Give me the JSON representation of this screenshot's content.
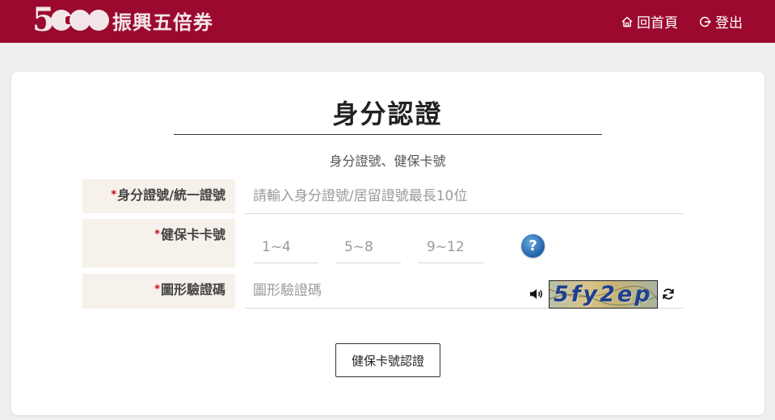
{
  "header": {
    "logo_number": "5000",
    "logo_text": "振興五倍券",
    "nav": {
      "home_label": "回首頁",
      "logout_label": "登出"
    }
  },
  "page": {
    "title": "身分認證",
    "subtitle": "身分證號、健保卡號"
  },
  "form": {
    "id": {
      "label": "身分證號/統一證號",
      "placeholder": "請輸入身分證號/居留證號最長10位",
      "value": ""
    },
    "nhi_card": {
      "label": "健保卡卡號",
      "segments": [
        {
          "placeholder": "1~4",
          "value": ""
        },
        {
          "placeholder": "5~8",
          "value": ""
        },
        {
          "placeholder": "9~12",
          "value": ""
        }
      ],
      "help_symbol": "?"
    },
    "captcha": {
      "label": "圖形驗證碼",
      "placeholder": "圖形驗證碼",
      "value": "",
      "image_text": "5fy2ep"
    },
    "required_mark": "*",
    "submit_label": "健保卡號認證"
  },
  "colors": {
    "brand": "#9b0a2e",
    "label_bg": "#f6f1ea",
    "required": "#d0021b"
  },
  "icons": {
    "home": "home-icon",
    "logout": "logout-icon",
    "help": "help-icon",
    "audio": "speaker-icon",
    "refresh": "refresh-icon"
  }
}
